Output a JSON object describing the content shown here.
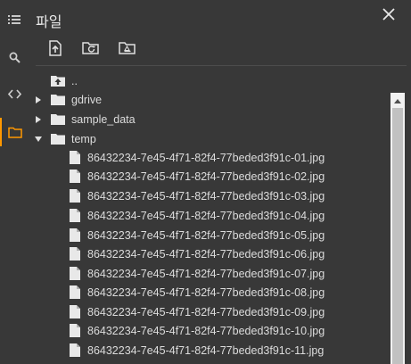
{
  "panel": {
    "title": "파일"
  },
  "rail": {
    "items": [
      {
        "icon": "list-icon"
      },
      {
        "icon": "search-icon"
      },
      {
        "icon": "code-icon"
      },
      {
        "icon": "folder-icon",
        "active": true
      }
    ]
  },
  "toolbar": {
    "items": [
      {
        "icon": "upload-file-icon"
      },
      {
        "icon": "refresh-folder-icon"
      },
      {
        "icon": "mount-drive-icon"
      }
    ]
  },
  "tree": {
    "parent_label": "..",
    "folders": [
      {
        "label": "gdrive",
        "expanded": false
      },
      {
        "label": "sample_data",
        "expanded": false
      },
      {
        "label": "temp",
        "expanded": true
      }
    ],
    "files": [
      "86432234-7e45-4f71-82f4-77beded3f91c-01.jpg",
      "86432234-7e45-4f71-82f4-77beded3f91c-02.jpg",
      "86432234-7e45-4f71-82f4-77beded3f91c-03.jpg",
      "86432234-7e45-4f71-82f4-77beded3f91c-04.jpg",
      "86432234-7e45-4f71-82f4-77beded3f91c-05.jpg",
      "86432234-7e45-4f71-82f4-77beded3f91c-06.jpg",
      "86432234-7e45-4f71-82f4-77beded3f91c-07.jpg",
      "86432234-7e45-4f71-82f4-77beded3f91c-08.jpg",
      "86432234-7e45-4f71-82f4-77beded3f91c-09.jpg",
      "86432234-7e45-4f71-82f4-77beded3f91c-10.jpg",
      "86432234-7e45-4f71-82f4-77beded3f91c-11.jpg"
    ]
  },
  "colors": {
    "background": "#383838",
    "accent": "#ff9800",
    "text": "#dcdcdc"
  }
}
